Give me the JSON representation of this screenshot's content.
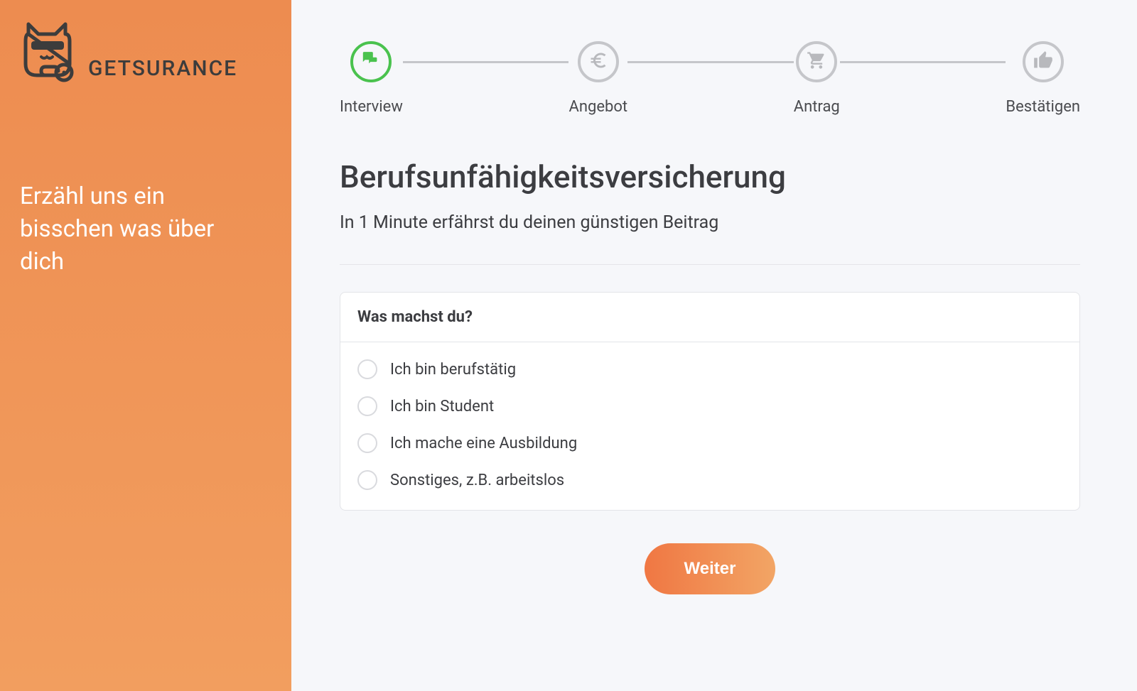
{
  "brand": {
    "name": "GETSURANCE"
  },
  "sidebar": {
    "heading": "Erzähl uns ein bisschen was über dich"
  },
  "stepper": {
    "steps": [
      {
        "label": "Interview",
        "icon": "chat-icon",
        "active": true
      },
      {
        "label": "Angebot",
        "icon": "euro-icon",
        "active": false
      },
      {
        "label": "Antrag",
        "icon": "cart-icon",
        "active": false
      },
      {
        "label": "Bestätigen",
        "icon": "thumbs-up-icon",
        "active": false
      }
    ]
  },
  "page": {
    "title": "Berufsunfähigkeitsversicherung",
    "subtitle": "In 1 Minute erfährst du deinen günstigen Beitrag"
  },
  "question": {
    "prompt": "Was machst du?",
    "options": [
      "Ich bin berufstätig",
      "Ich bin Student",
      "Ich mache eine Ausbildung",
      "Sonstiges, z.B. arbeitslos"
    ]
  },
  "actions": {
    "next": "Weiter"
  }
}
